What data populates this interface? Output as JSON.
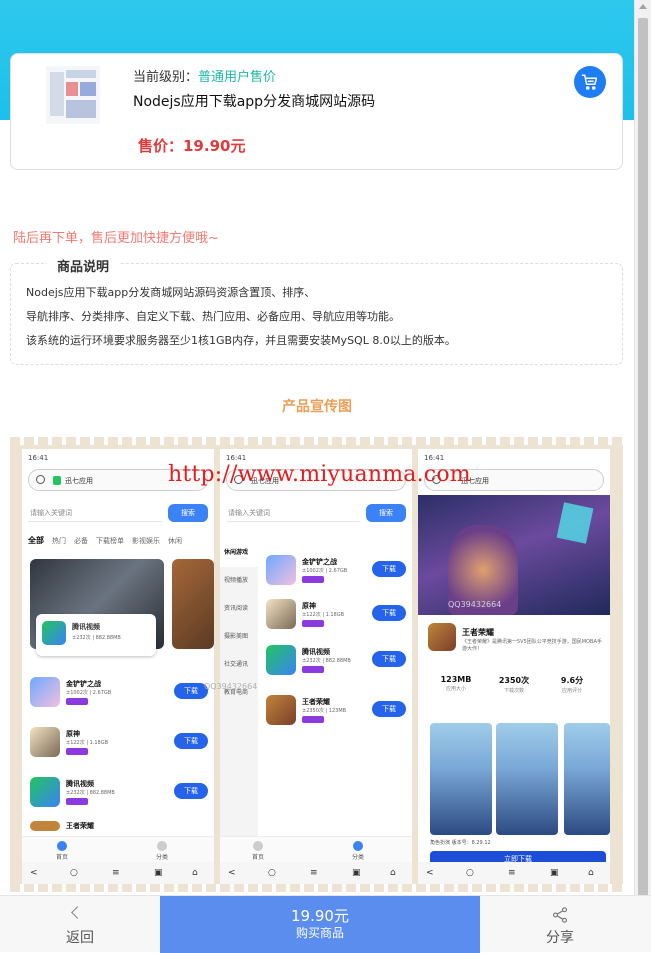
{
  "product": {
    "level_label": "当前级别：",
    "level_value": "普通用户售价",
    "title": "Nodejs应用下载app分发商城网站源码",
    "price_label": "售价：19.90元"
  },
  "notice": "陆后再下单，售后更加快捷方便哦~",
  "description": {
    "title": "商品说明",
    "lines": [
      "Nodejs应用下载app分发商城网站源码资源含置顶、排序、",
      "导航排序、分类排序、自定义下载、热门应用、必备应用、导航应用等功能。",
      "该系统的运行环境要求服务器至少1核1GB内存，并且需要安装MySQL 8.0以上的版本。"
    ]
  },
  "promo": {
    "heading": "产品宣传图",
    "watermark": "http://www.miyuanma.com",
    "watermark_qq": "QQ39432664",
    "phone1": {
      "time": "16:41",
      "search_text": "迅七应用",
      "search_placeholder": "请输入关键词",
      "search_button": "搜索",
      "tabs": [
        "全部",
        "热门",
        "必备",
        "下载榜单",
        "影视娱乐",
        "休闲"
      ],
      "banner_app": "腾讯视频",
      "banner_meta": "±232次 | 882.88MB",
      "apps": [
        {
          "name": "金铲铲之战",
          "meta": "±1002次 | 2.67GB",
          "btn": "下载"
        },
        {
          "name": "原神",
          "meta": "±122次 | 1.18GB",
          "btn": "下载"
        },
        {
          "name": "腾讯视频",
          "meta": "±232次 | 882.88MB",
          "btn": "下载"
        },
        {
          "name": "王者荣耀",
          "meta": "",
          "btn": ""
        }
      ],
      "nav": [
        "首页",
        "分类"
      ]
    },
    "phone2": {
      "time": "16:41",
      "search_text": "迅七应用",
      "search_placeholder": "请输入关键词",
      "search_button": "搜索",
      "menu": [
        "休闲游戏",
        "视频播放",
        "资讯阅读",
        "摄影美图",
        "社交通讯",
        "教育电商"
      ],
      "apps": [
        {
          "name": "金铲铲之战",
          "meta": "±1002次 | 2.67GB",
          "btn": "下载"
        },
        {
          "name": "原神",
          "meta": "±122次 | 1.18GB",
          "btn": "下载"
        },
        {
          "name": "腾讯视频",
          "meta": "±232次 | 882.88MB",
          "btn": "下载"
        },
        {
          "name": "王者荣耀",
          "meta": "±2350次 | 123MB",
          "btn": "下载"
        }
      ],
      "nav": [
        "首页",
        "分类"
      ]
    },
    "phone3": {
      "time": "16:41",
      "search_text": "迅七应用",
      "game_title": "王者荣耀",
      "game_desc": "《王者荣耀》是腾讯第一5V5团队公平竞技手游，国民MOBA手游大作！",
      "stats": [
        {
          "value": "123MB",
          "label": "应用大小"
        },
        {
          "value": "2350次",
          "label": "下载次数"
        },
        {
          "value": "9.6分",
          "label": "应用评分"
        }
      ],
      "version": "角色扮演   版本号：8.29.12",
      "install_button": "立即下载"
    }
  },
  "bottom_bar": {
    "back_label": "返回",
    "buy_price": "19.90元",
    "buy_label": "购买商品",
    "share_label": "分享"
  },
  "colors": {
    "banner": "#1cc0ea",
    "price_red": "#e4393c",
    "level_teal": "#1fb8a8",
    "notice": "#f27a72",
    "promo_heading": "#e8a057",
    "buy_button": "#5b8def",
    "cart_button": "#1e7df2"
  },
  "icons": {
    "cart": "shopping-cart-icon",
    "back": "chevron-left-icon",
    "share": "share-icon"
  }
}
